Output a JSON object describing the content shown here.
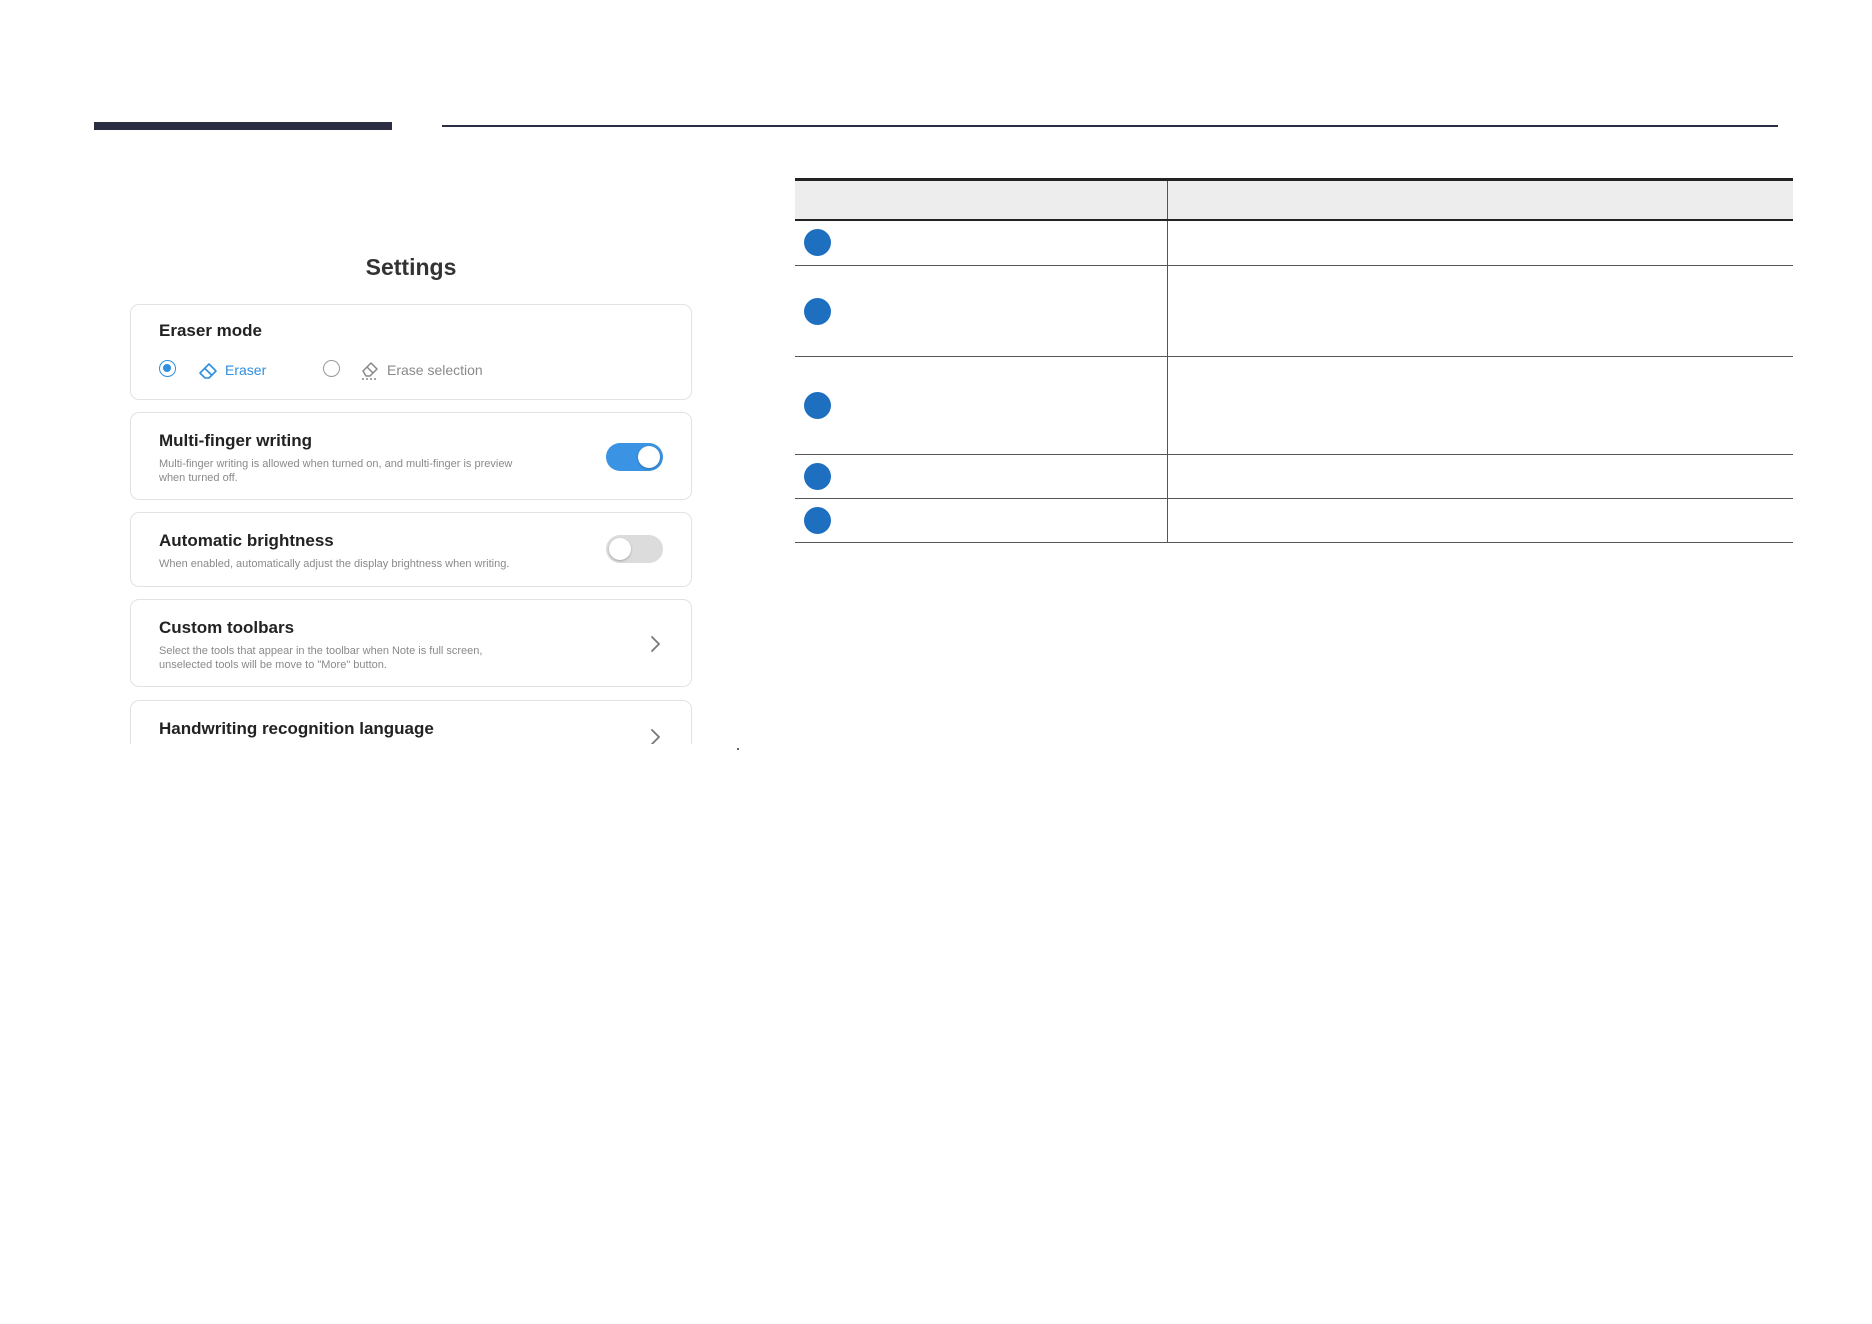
{
  "settings": {
    "title": "Settings",
    "eraser_mode": {
      "title": "Eraser mode",
      "options": [
        {
          "label": "Eraser",
          "selected": true,
          "icon": "eraser-icon"
        },
        {
          "label": "Erase selection",
          "selected": false,
          "icon": "erase-selection-icon"
        }
      ]
    },
    "multi_finger": {
      "title": "Multi-finger writing",
      "desc_line1": "Multi-finger writing is allowed when turned on, and multi-finger is preview",
      "desc_line2": "when turned off.",
      "enabled": true
    },
    "auto_brightness": {
      "title": "Automatic brightness",
      "desc": "When enabled, automatically adjust the display brightness when writing.",
      "enabled": false
    },
    "custom_toolbars": {
      "title": "Custom toolbars",
      "desc_line1": "Select the tools that appear in the toolbar when Note is full screen,",
      "desc_line2": "unselected tools will be move to \"More\" button."
    },
    "handwriting": {
      "title": "Handwriting recognition language"
    }
  },
  "table": {
    "headers": [
      "",
      ""
    ],
    "rows": [
      {
        "marker": "badge",
        "description": ""
      },
      {
        "marker": "badge",
        "description": ""
      },
      {
        "marker": "badge",
        "description": ""
      },
      {
        "marker": "badge",
        "description": ""
      },
      {
        "marker": "badge",
        "description": ""
      }
    ]
  },
  "colors": {
    "accent": "#2f8fe0",
    "badge": "#1e6fc0",
    "rule": "#2b2d42"
  }
}
